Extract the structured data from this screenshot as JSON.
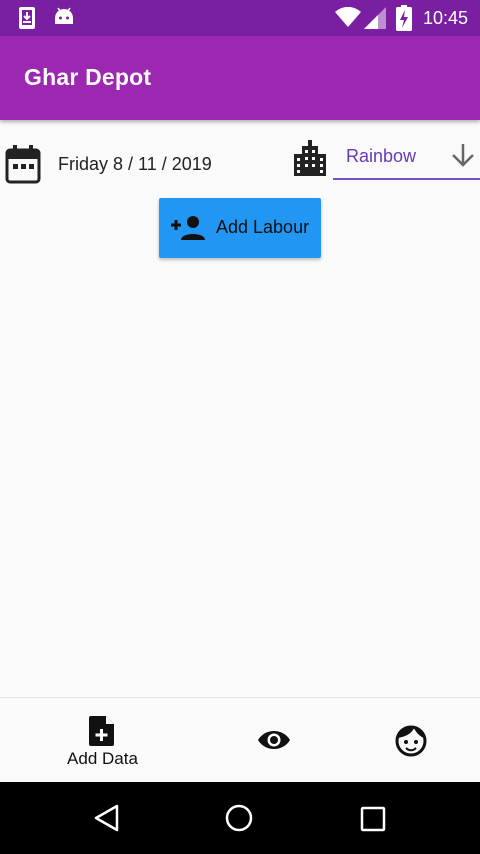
{
  "status_bar": {
    "time": "10:45",
    "icons": [
      "download-notification-icon",
      "android-icon",
      "wifi-icon",
      "signal-icon",
      "battery-charging-icon"
    ]
  },
  "app_bar": {
    "title": "Ghar Depot"
  },
  "date_row": {
    "date_text": "Friday 8 / 11 / 2019",
    "icon": "calendar-icon"
  },
  "site_dropdown": {
    "icon": "building-icon",
    "selected": "Rainbow",
    "arrow_icon": "arrow-down-icon",
    "underline_color": "#7c4dcf"
  },
  "add_labour_button": {
    "label": "Add Labour",
    "icon": "person-add-icon",
    "color": "#2196f3"
  },
  "bottom_nav": {
    "items": [
      {
        "label": "Add Data",
        "icon": "note-add-icon"
      },
      {
        "label": "",
        "icon": "eye-icon"
      },
      {
        "label": "",
        "icon": "face-icon"
      }
    ]
  },
  "system_nav": {
    "buttons": [
      "back-icon",
      "home-icon",
      "recents-icon"
    ]
  },
  "colors": {
    "status_bar": "#7b1fa2",
    "app_bar": "#9c27b0",
    "accent": "#673ab7"
  }
}
